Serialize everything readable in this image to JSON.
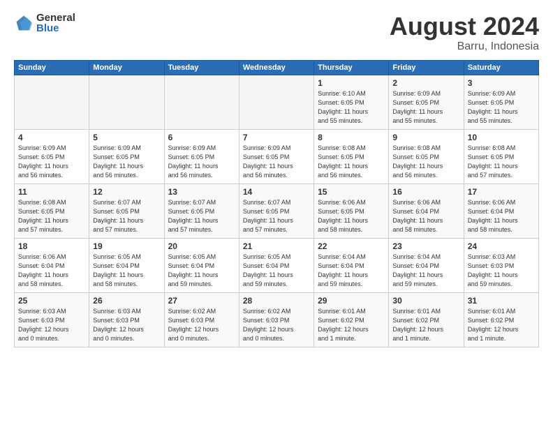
{
  "logo": {
    "general": "General",
    "blue": "Blue"
  },
  "title": "August 2024",
  "subtitle": "Barru, Indonesia",
  "days_header": [
    "Sunday",
    "Monday",
    "Tuesday",
    "Wednesday",
    "Thursday",
    "Friday",
    "Saturday"
  ],
  "weeks": [
    [
      {
        "day": "",
        "info": ""
      },
      {
        "day": "",
        "info": ""
      },
      {
        "day": "",
        "info": ""
      },
      {
        "day": "",
        "info": ""
      },
      {
        "day": "1",
        "info": "Sunrise: 6:10 AM\nSunset: 6:05 PM\nDaylight: 11 hours\nand 55 minutes."
      },
      {
        "day": "2",
        "info": "Sunrise: 6:09 AM\nSunset: 6:05 PM\nDaylight: 11 hours\nand 55 minutes."
      },
      {
        "day": "3",
        "info": "Sunrise: 6:09 AM\nSunset: 6:05 PM\nDaylight: 11 hours\nand 55 minutes."
      }
    ],
    [
      {
        "day": "4",
        "info": "Sunrise: 6:09 AM\nSunset: 6:05 PM\nDaylight: 11 hours\nand 56 minutes."
      },
      {
        "day": "5",
        "info": "Sunrise: 6:09 AM\nSunset: 6:05 PM\nDaylight: 11 hours\nand 56 minutes."
      },
      {
        "day": "6",
        "info": "Sunrise: 6:09 AM\nSunset: 6:05 PM\nDaylight: 11 hours\nand 56 minutes."
      },
      {
        "day": "7",
        "info": "Sunrise: 6:09 AM\nSunset: 6:05 PM\nDaylight: 11 hours\nand 56 minutes."
      },
      {
        "day": "8",
        "info": "Sunrise: 6:08 AM\nSunset: 6:05 PM\nDaylight: 11 hours\nand 56 minutes."
      },
      {
        "day": "9",
        "info": "Sunrise: 6:08 AM\nSunset: 6:05 PM\nDaylight: 11 hours\nand 56 minutes."
      },
      {
        "day": "10",
        "info": "Sunrise: 6:08 AM\nSunset: 6:05 PM\nDaylight: 11 hours\nand 57 minutes."
      }
    ],
    [
      {
        "day": "11",
        "info": "Sunrise: 6:08 AM\nSunset: 6:05 PM\nDaylight: 11 hours\nand 57 minutes."
      },
      {
        "day": "12",
        "info": "Sunrise: 6:07 AM\nSunset: 6:05 PM\nDaylight: 11 hours\nand 57 minutes."
      },
      {
        "day": "13",
        "info": "Sunrise: 6:07 AM\nSunset: 6:05 PM\nDaylight: 11 hours\nand 57 minutes."
      },
      {
        "day": "14",
        "info": "Sunrise: 6:07 AM\nSunset: 6:05 PM\nDaylight: 11 hours\nand 57 minutes."
      },
      {
        "day": "15",
        "info": "Sunrise: 6:06 AM\nSunset: 6:05 PM\nDaylight: 11 hours\nand 58 minutes."
      },
      {
        "day": "16",
        "info": "Sunrise: 6:06 AM\nSunset: 6:04 PM\nDaylight: 11 hours\nand 58 minutes."
      },
      {
        "day": "17",
        "info": "Sunrise: 6:06 AM\nSunset: 6:04 PM\nDaylight: 11 hours\nand 58 minutes."
      }
    ],
    [
      {
        "day": "18",
        "info": "Sunrise: 6:06 AM\nSunset: 6:04 PM\nDaylight: 11 hours\nand 58 minutes."
      },
      {
        "day": "19",
        "info": "Sunrise: 6:05 AM\nSunset: 6:04 PM\nDaylight: 11 hours\nand 58 minutes."
      },
      {
        "day": "20",
        "info": "Sunrise: 6:05 AM\nSunset: 6:04 PM\nDaylight: 11 hours\nand 59 minutes."
      },
      {
        "day": "21",
        "info": "Sunrise: 6:05 AM\nSunset: 6:04 PM\nDaylight: 11 hours\nand 59 minutes."
      },
      {
        "day": "22",
        "info": "Sunrise: 6:04 AM\nSunset: 6:04 PM\nDaylight: 11 hours\nand 59 minutes."
      },
      {
        "day": "23",
        "info": "Sunrise: 6:04 AM\nSunset: 6:04 PM\nDaylight: 11 hours\nand 59 minutes."
      },
      {
        "day": "24",
        "info": "Sunrise: 6:03 AM\nSunset: 6:03 PM\nDaylight: 11 hours\nand 59 minutes."
      }
    ],
    [
      {
        "day": "25",
        "info": "Sunrise: 6:03 AM\nSunset: 6:03 PM\nDaylight: 12 hours\nand 0 minutes."
      },
      {
        "day": "26",
        "info": "Sunrise: 6:03 AM\nSunset: 6:03 PM\nDaylight: 12 hours\nand 0 minutes."
      },
      {
        "day": "27",
        "info": "Sunrise: 6:02 AM\nSunset: 6:03 PM\nDaylight: 12 hours\nand 0 minutes."
      },
      {
        "day": "28",
        "info": "Sunrise: 6:02 AM\nSunset: 6:03 PM\nDaylight: 12 hours\nand 0 minutes."
      },
      {
        "day": "29",
        "info": "Sunrise: 6:01 AM\nSunset: 6:02 PM\nDaylight: 12 hours\nand 1 minute."
      },
      {
        "day": "30",
        "info": "Sunrise: 6:01 AM\nSunset: 6:02 PM\nDaylight: 12 hours\nand 1 minute."
      },
      {
        "day": "31",
        "info": "Sunrise: 6:01 AM\nSunset: 6:02 PM\nDaylight: 12 hours\nand 1 minute."
      }
    ]
  ]
}
